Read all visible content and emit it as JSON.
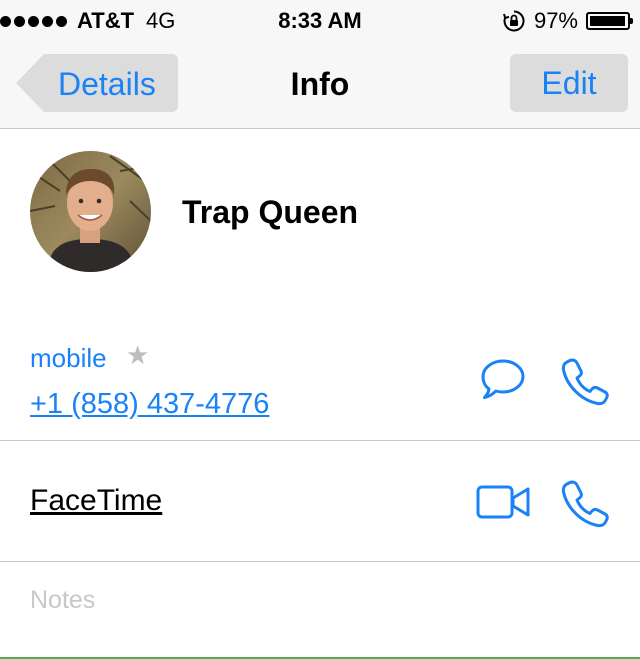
{
  "status_bar": {
    "carrier": "AT&T",
    "network": "4G",
    "time": "8:33 AM",
    "battery_percent": "97%",
    "battery_level": 0.97
  },
  "nav": {
    "back_label": "Details",
    "title": "Info",
    "edit_label": "Edit"
  },
  "contact": {
    "name": "Trap Queen"
  },
  "phone": {
    "label": "mobile",
    "number": "+1 (858) 437-4776"
  },
  "facetime": {
    "label": "FaceTime"
  },
  "notes": {
    "placeholder": "Notes"
  },
  "colors": {
    "accent": "#1a82f7"
  }
}
